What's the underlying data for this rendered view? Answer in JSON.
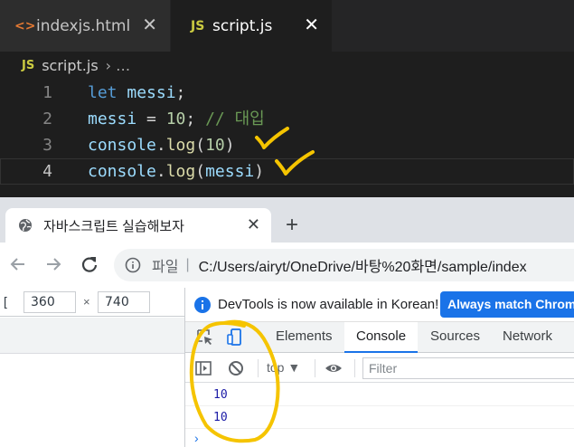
{
  "editor": {
    "tabs": [
      {
        "icon": "<>",
        "label": "indexjs.html",
        "close": "✕"
      },
      {
        "icon": "JS",
        "label": "script.js",
        "close": "✕"
      }
    ],
    "breadcrumb": {
      "icon": "JS",
      "file": "script.js",
      "sep": "› …"
    },
    "lines": [
      {
        "num": "1",
        "parts": [
          {
            "t": "let",
            "c": "kw"
          },
          {
            "t": " ",
            "c": "op"
          },
          {
            "t": "messi",
            "c": "var"
          },
          {
            "t": ";",
            "c": "op"
          }
        ]
      },
      {
        "num": "2",
        "parts": [
          {
            "t": "messi",
            "c": "var"
          },
          {
            "t": " = ",
            "c": "op"
          },
          {
            "t": "10",
            "c": "num"
          },
          {
            "t": "; ",
            "c": "op"
          },
          {
            "t": "// 대입",
            "c": "cmt"
          }
        ]
      },
      {
        "num": "3",
        "parts": [
          {
            "t": "console",
            "c": "var"
          },
          {
            "t": ".",
            "c": "op"
          },
          {
            "t": "log",
            "c": "fn"
          },
          {
            "t": "(",
            "c": "op"
          },
          {
            "t": "10",
            "c": "num"
          },
          {
            "t": ")",
            "c": "op"
          }
        ]
      },
      {
        "num": "4",
        "parts": [
          {
            "t": "console",
            "c": "var"
          },
          {
            "t": ".",
            "c": "op"
          },
          {
            "t": "log",
            "c": "fn"
          },
          {
            "t": "(",
            "c": "op"
          },
          {
            "t": "messi",
            "c": "var"
          },
          {
            "t": ")",
            "c": "op"
          }
        ]
      }
    ]
  },
  "browser": {
    "tab_title": "자바스크립트 실습해보자",
    "tab_close": "✕",
    "new_tab": "+",
    "address": {
      "label": "파일",
      "sep": "|",
      "url": "C:/Users/airyt/OneDrive/바탕%20화면/sample/index"
    }
  },
  "device_toolbar": {
    "bracket": "[",
    "width": "360",
    "times": "×",
    "height": "740"
  },
  "devtools": {
    "infobar_text": "DevTools is now available in Korean!",
    "infobar_button": "Always match Chrome",
    "tabs": [
      "Elements",
      "Console",
      "Sources",
      "Network"
    ],
    "active_tab": "Console",
    "context": "top ▼",
    "filter_placeholder": "Filter",
    "console_output": [
      "10",
      "10"
    ],
    "prompt": "›"
  },
  "colors": {
    "accent": "#1a73e8",
    "annotation": "#f5c400"
  }
}
